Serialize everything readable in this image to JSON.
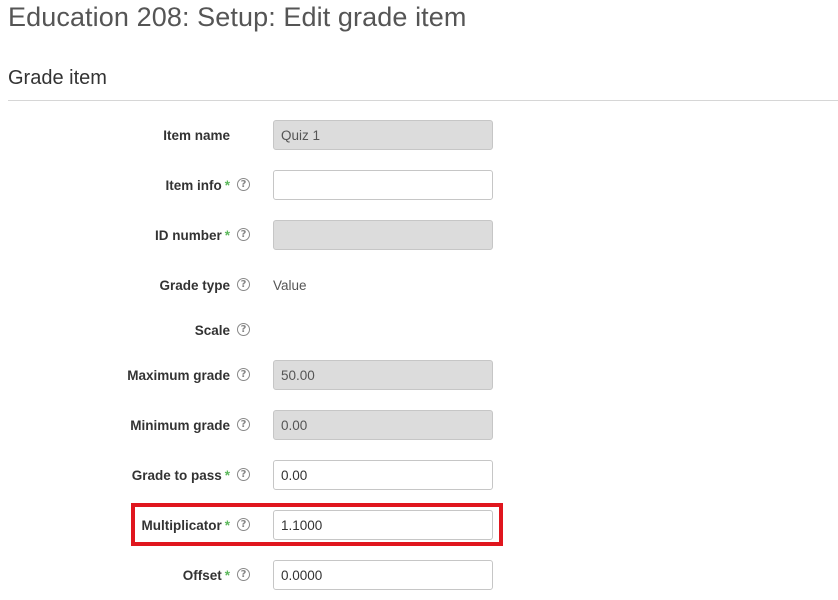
{
  "header": {
    "page_title": "Education 208: Setup: Edit grade item"
  },
  "section": {
    "title": "Grade item"
  },
  "fields": [
    {
      "id": "item-name",
      "label": "Item name",
      "required": false,
      "help": false,
      "kind": "input",
      "disabled": true,
      "value": "Quiz 1"
    },
    {
      "id": "item-info",
      "label": "Item info",
      "required": true,
      "help": true,
      "kind": "input",
      "disabled": false,
      "value": ""
    },
    {
      "id": "id-number",
      "label": "ID number",
      "required": true,
      "help": true,
      "kind": "input",
      "disabled": true,
      "value": ""
    },
    {
      "id": "grade-type",
      "label": "Grade type",
      "required": false,
      "help": true,
      "kind": "static",
      "disabled": false,
      "value": "Value"
    },
    {
      "id": "scale",
      "label": "Scale",
      "required": false,
      "help": true,
      "kind": "static",
      "disabled": false,
      "value": ""
    },
    {
      "id": "maximum-grade",
      "label": "Maximum grade",
      "required": false,
      "help": true,
      "kind": "input",
      "disabled": true,
      "value": "50.00"
    },
    {
      "id": "minimum-grade",
      "label": "Minimum grade",
      "required": false,
      "help": true,
      "kind": "input",
      "disabled": true,
      "value": "0.00"
    },
    {
      "id": "grade-to-pass",
      "label": "Grade to pass",
      "required": true,
      "help": true,
      "kind": "input",
      "disabled": false,
      "value": "0.00"
    },
    {
      "id": "multiplicator",
      "label": "Multiplicator",
      "required": true,
      "help": true,
      "kind": "input",
      "disabled": false,
      "value": "1.1000",
      "highlighted": true
    },
    {
      "id": "offset",
      "label": "Offset",
      "required": true,
      "help": true,
      "kind": "input",
      "disabled": false,
      "value": "0.0000"
    }
  ],
  "icons": {
    "help": "question-circle-icon",
    "required": "asterisk"
  },
  "colors": {
    "required": "#5cb85c",
    "highlight": "#e0161e",
    "disabled_bg": "#dcdcdc"
  }
}
